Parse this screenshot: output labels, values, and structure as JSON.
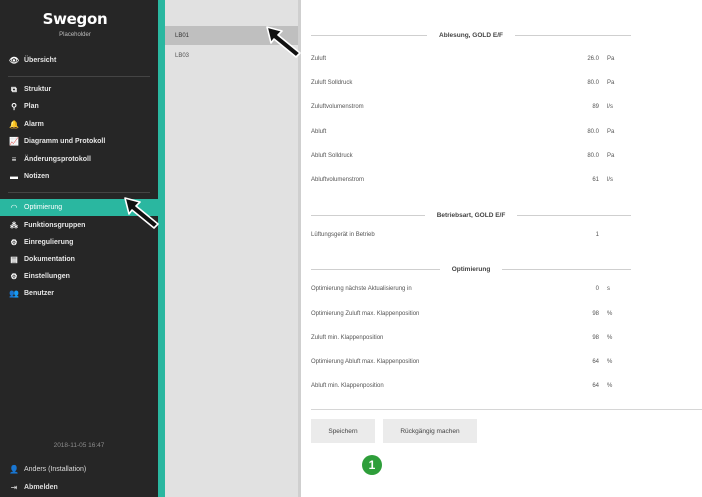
{
  "sidebar": {
    "brand": "Swegon",
    "subtitle": "Placeholder",
    "items": [
      {
        "label": "Übersicht",
        "icon": "eye-icon",
        "glyph": "👁"
      },
      {
        "label": "Struktur",
        "icon": "structure-icon",
        "glyph": "⧉"
      },
      {
        "label": "Plan",
        "icon": "map-pin-icon",
        "glyph": "⚲"
      },
      {
        "label": "Alarm",
        "icon": "bell-icon",
        "glyph": "🔔"
      },
      {
        "label": "Diagramm und Protokoll",
        "icon": "chart-icon",
        "glyph": "📈"
      },
      {
        "label": "Änderungsprotokoll",
        "icon": "list-icon",
        "glyph": "≡"
      },
      {
        "label": "Notizen",
        "icon": "note-icon",
        "glyph": "▬"
      },
      {
        "label": "Optimierung",
        "icon": "gauge-icon",
        "glyph": "◠"
      },
      {
        "label": "Funktionsgruppen",
        "icon": "group-icon",
        "glyph": "⁂"
      },
      {
        "label": "Einregulierung",
        "icon": "adjust-icon",
        "glyph": "⚙"
      },
      {
        "label": "Dokumentation",
        "icon": "document-icon",
        "glyph": "▤"
      },
      {
        "label": "Einstellungen",
        "icon": "settings-icon",
        "glyph": "⚙"
      },
      {
        "label": "Benutzer",
        "icon": "users-icon",
        "glyph": "👥"
      }
    ],
    "timestamp": "2018-11-05 16:47",
    "user": "Anders (Installation)",
    "logout": "Abmelden"
  },
  "list": {
    "items": [
      "LB01",
      "LB03"
    ],
    "selected": "LB01"
  },
  "main": {
    "sections": [
      {
        "title": "Ablesung, GOLD E/F",
        "rows": [
          {
            "label": "Zuluft",
            "value": "26.0",
            "unit": "Pa"
          },
          {
            "label": "Zuluft Solldruck",
            "value": "80.0",
            "unit": "Pa"
          },
          {
            "label": "Zuluftvolumenstrom",
            "value": "89",
            "unit": "l/s"
          },
          {
            "label": "Abluft",
            "value": "80.0",
            "unit": "Pa"
          },
          {
            "label": "Abluft Solldruck",
            "value": "80.0",
            "unit": "Pa"
          },
          {
            "label": "Abluftvolumenstrom",
            "value": "61",
            "unit": "l/s"
          }
        ]
      },
      {
        "title": "Betriebsart, GOLD E/F",
        "rows": [
          {
            "label": "Lüftungsgerät in Betrieb",
            "value": "1",
            "unit": ""
          }
        ]
      },
      {
        "title": "Optimierung",
        "rows": [
          {
            "label": "Optimierung nächste Aktualisierung in",
            "value": "0",
            "unit": "s"
          },
          {
            "label": "Optimierung Zuluft max. Klappenposition",
            "value": "98",
            "unit": "%"
          },
          {
            "label": "Zuluft min. Klappenposition",
            "value": "98",
            "unit": "%"
          },
          {
            "label": "Optimierung Abluft max. Klappenposition",
            "value": "64",
            "unit": "%"
          },
          {
            "label": "Abluft min. Klappenposition",
            "value": "64",
            "unit": "%"
          }
        ]
      }
    ],
    "buttons": {
      "save": "Speichern",
      "undo": "Rückgängig machen"
    },
    "callout_number": "1"
  },
  "colors": {
    "accent": "#2ab7a0",
    "sidebar_bg": "#262626",
    "badge": "#2e9e3a"
  }
}
